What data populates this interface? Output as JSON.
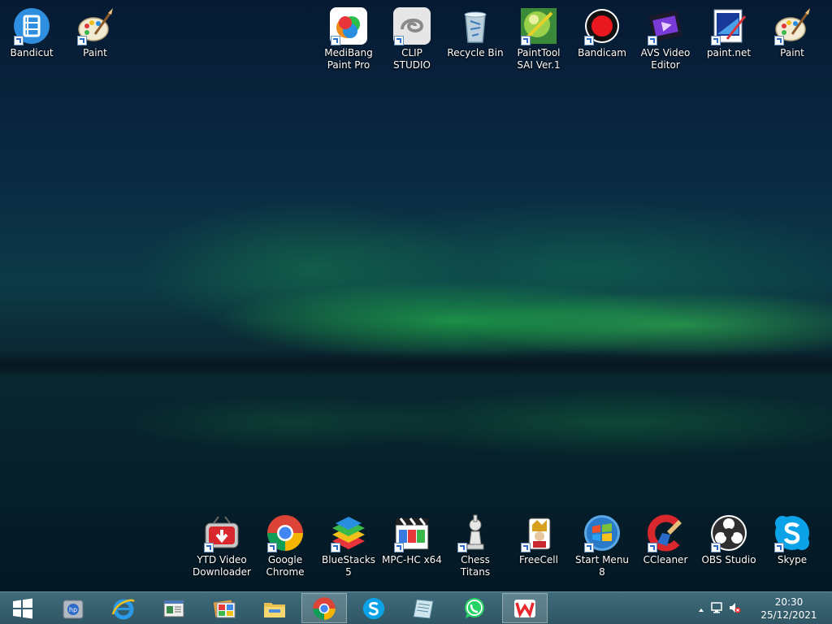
{
  "desktop": {
    "top_icons_left": [
      {
        "label": "Bandicut",
        "icon": "bandicut-icon"
      },
      {
        "label": "Paint",
        "icon": "paint-icon"
      }
    ],
    "top_icons_right": [
      {
        "label": "MediBang Paint Pro",
        "icon": "medibang-icon"
      },
      {
        "label": "CLIP STUDIO",
        "icon": "clip-studio-icon"
      },
      {
        "label": "Recycle Bin",
        "icon": "recycle-bin-icon"
      },
      {
        "label": "PaintTool SAI Ver.1",
        "icon": "painttool-sai-icon"
      },
      {
        "label": "Bandicam",
        "icon": "bandicam-icon"
      },
      {
        "label": "AVS Video Editor",
        "icon": "avs-video-editor-icon"
      },
      {
        "label": "paint.net",
        "icon": "paint-net-icon"
      },
      {
        "label": "Paint",
        "icon": "paint-icon"
      }
    ],
    "bottom_icons": [
      {
        "label": "YTD Video Downloader",
        "icon": "ytd-icon"
      },
      {
        "label": "Google Chrome",
        "icon": "chrome-icon"
      },
      {
        "label": "BlueStacks 5",
        "icon": "bluestacks-icon"
      },
      {
        "label": "MPC-HC x64",
        "icon": "mpc-hc-icon"
      },
      {
        "label": "Chess Titans",
        "icon": "chess-icon"
      },
      {
        "label": "FreeCell",
        "icon": "freecell-icon"
      },
      {
        "label": "Start Menu 8",
        "icon": "start-menu-8-icon"
      },
      {
        "label": "CCleaner",
        "icon": "ccleaner-icon"
      },
      {
        "label": "OBS Studio",
        "icon": "obs-icon"
      },
      {
        "label": "Skype",
        "icon": "skype-icon"
      }
    ]
  },
  "taskbar": {
    "buttons": [
      {
        "icon": "windows-start-icon"
      },
      {
        "icon": "hp-icon"
      },
      {
        "icon": "internet-explorer-icon"
      },
      {
        "icon": "window-app-icon"
      },
      {
        "icon": "photo-gallery-icon"
      },
      {
        "icon": "file-explorer-icon"
      },
      {
        "icon": "chrome-icon",
        "active": true
      },
      {
        "icon": "skype-icon"
      },
      {
        "icon": "notebook-icon"
      },
      {
        "icon": "whatsapp-icon"
      },
      {
        "icon": "wps-office-icon",
        "active": true
      }
    ],
    "tray": {
      "icons": [
        "chevron-up-icon",
        "network-icon",
        "volume-muted-icon"
      ],
      "time": "20:30",
      "date": "25/12/2021"
    }
  },
  "colors": {
    "taskbar": "#3a6472",
    "aurora": "#33d35a"
  }
}
